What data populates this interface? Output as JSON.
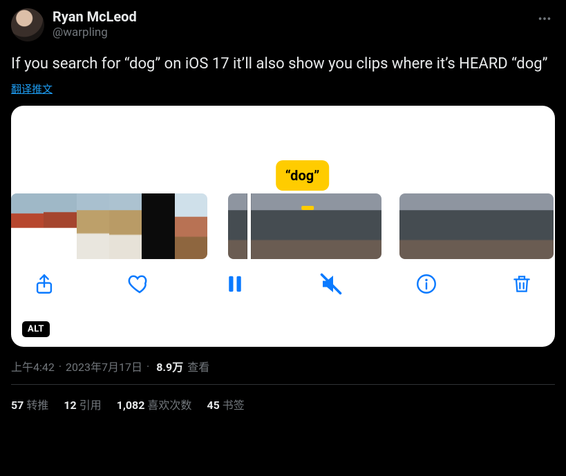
{
  "author": {
    "name": "Ryan McLeod",
    "handle": "@warpling"
  },
  "body": "If you search for “dog” on iOS 17 it’ll also show you clips where it’s HEARD “dog”",
  "translate_label": "翻译推文",
  "media": {
    "tooltip": "“dog”",
    "alt_badge": "ALT"
  },
  "meta": {
    "time": "上午4:42",
    "date": "2023年7月17日",
    "views_value": "8.9万",
    "views_label": "查看"
  },
  "stats": {
    "retweets": {
      "value": "57",
      "label": "转推"
    },
    "quotes": {
      "value": "12",
      "label": "引用"
    },
    "likes": {
      "value": "1,082",
      "label": "喜欢次数"
    },
    "bookmarks": {
      "value": "45",
      "label": "书签"
    }
  }
}
